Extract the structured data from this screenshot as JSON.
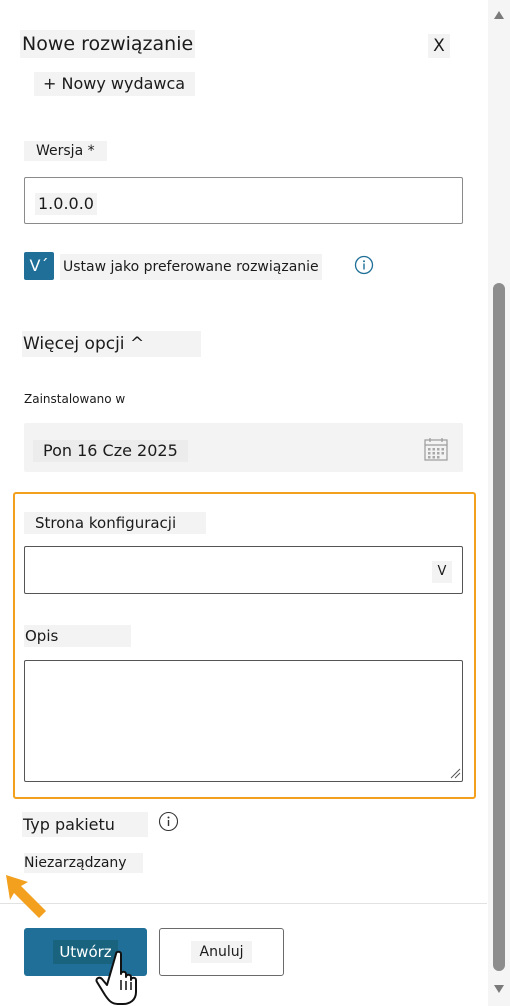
{
  "panel": {
    "title": "Nowe rozwiązanie",
    "close_label": "X",
    "new_publisher_label": "+ Nowy wydawca"
  },
  "version": {
    "label": "Wersja *",
    "value": "1.0.0.0"
  },
  "preferred": {
    "checkbox_glyph": "V´",
    "label": "Ustaw jako preferowane rozwiązanie",
    "info_icon": "info-icon",
    "checked": true
  },
  "more_options": {
    "label": "Więcej opcji ^"
  },
  "installed": {
    "label": "Zainstalowano w",
    "value": "Pon 16 Cze 2025",
    "icon": "calendar-icon"
  },
  "config_page": {
    "label": "Strona konfiguracji",
    "value": "",
    "chevron": "V"
  },
  "description": {
    "label": "Opis",
    "value": ""
  },
  "package_type": {
    "label": "Typ pakietu",
    "value": "Niezarządzany",
    "info_icon": "info-icon"
  },
  "footer": {
    "create_label": "Utwórz",
    "cancel_label": "Anuluj"
  },
  "colors": {
    "accent": "#1f6f98",
    "highlight": "#f2a01d",
    "scroll_thumb": "#8d8d8d"
  }
}
